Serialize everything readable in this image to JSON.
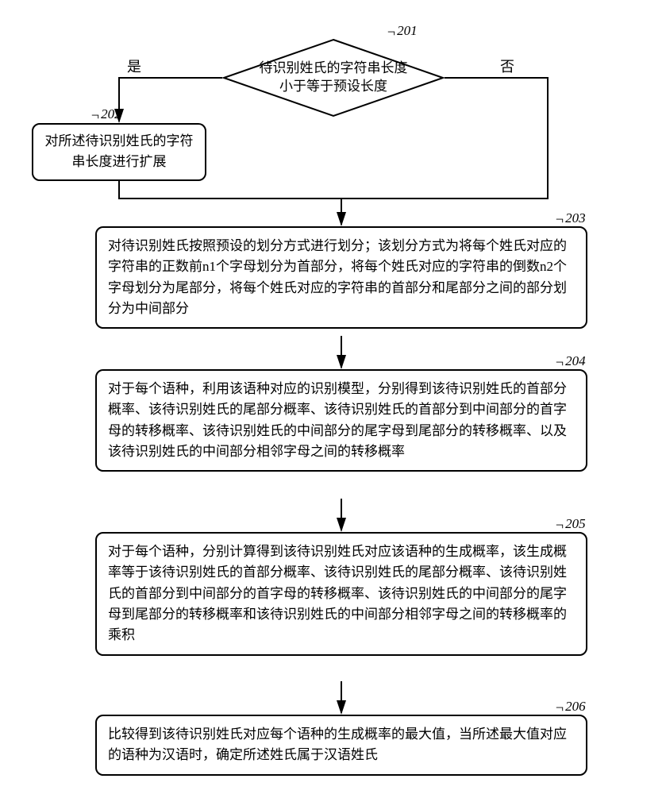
{
  "decision": {
    "text": "待识别姓氏的字符串长度小于等于预设长度",
    "yes": "是",
    "no": "否",
    "ref": "201"
  },
  "step202": {
    "text": "对所述待识别姓氏的字符串长度进行扩展",
    "ref": "202"
  },
  "step203": {
    "text": "对待识别姓氏按照预设的划分方式进行划分；该划分方式为将每个姓氏对应的字符串的正数前n1个字母划分为首部分，将每个姓氏对应的字符串的倒数n2个字母划分为尾部分，将每个姓氏对应的字符串的首部分和尾部分之间的部分划分为中间部分",
    "ref": "203"
  },
  "step204": {
    "text": "对于每个语种，利用该语种对应的识别模型，分别得到该待识别姓氏的首部分概率、该待识别姓氏的尾部分概率、该待识别姓氏的首部分到中间部分的首字母的转移概率、该待识别姓氏的中间部分的尾字母到尾部分的转移概率、以及该待识别姓氏的中间部分相邻字母之间的转移概率",
    "ref": "204"
  },
  "step205": {
    "text": "对于每个语种，分别计算得到该待识别姓氏对应该语种的生成概率，该生成概率等于该待识别姓氏的首部分概率、该待识别姓氏的尾部分概率、该待识别姓氏的首部分到中间部分的首字母的转移概率、该待识别姓氏的中间部分的尾字母到尾部分的转移概率和该待识别姓氏的中间部分相邻字母之间的转移概率的乘积",
    "ref": "205"
  },
  "step206": {
    "text": "比较得到该待识别姓氏对应每个语种的生成概率的最大值，当所述最大值对应的语种为汉语时，确定所述姓氏属于汉语姓氏",
    "ref": "206"
  }
}
